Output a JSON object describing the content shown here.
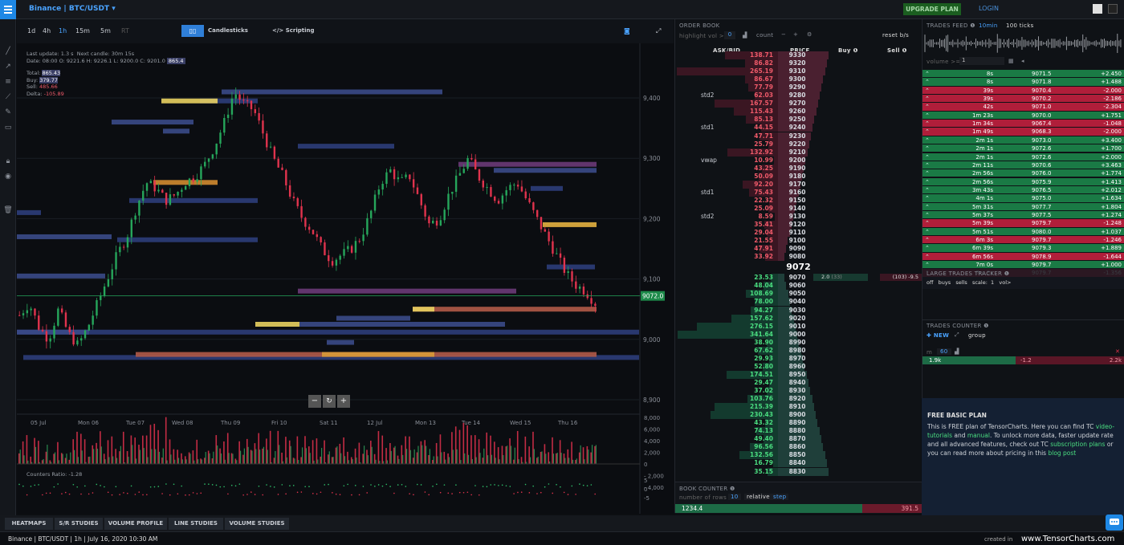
{
  "app": {
    "pair": "Binance | BTC/USDT",
    "upgrade": "UPGRADE PLAN",
    "login": "LOGIN"
  },
  "chart": {
    "timeframes": [
      "1d",
      "4h",
      "1h",
      "15m",
      "5m",
      "RT"
    ],
    "active_tf": "1h",
    "type_label": "Candlesticks",
    "scripting": "</> Scripting",
    "info": {
      "last_update": "Last update: 1.3 s",
      "next_candle": "Next candle: 30m 15s",
      "ohlc": "Date: 08:00 O: 9221.6 H: 9226.1 L: 9200.0 C: 9201.0",
      "vol": "865.4",
      "total_label": "Total:",
      "total": "865.43",
      "buy_label": "Buy:",
      "buy": "379.77",
      "sell_label": "Sell:",
      "sell": "485.66",
      "delta_label": "Delta:",
      "delta": "-105.89"
    },
    "price_ticks": [
      "9,400",
      "9,300",
      "9,200",
      "9,100",
      "9,000",
      "8,900"
    ],
    "current_price": "9072.0",
    "dates": [
      "05 Jul",
      "Mon 06",
      "Tue 07",
      "Wed 08",
      "Thu 09",
      "Fri 10",
      "Sat 11",
      "12 Jul",
      "Mon 13",
      "Tue 14",
      "Wed 15",
      "Thu 16"
    ],
    "vol_ticks": [
      "8,000",
      "6,000",
      "4,000",
      "2,000",
      "0",
      "2,000",
      "4,000"
    ],
    "ratio_label": "Counters Ratio:",
    "ratio": "-1.28",
    "ratio_ticks": [
      "5",
      "0",
      "-5"
    ]
  },
  "orderbook": {
    "title": "ORDER BOOK",
    "highlight": "highlight vol >",
    "hl_val": "0",
    "count": "count",
    "reset": "reset b/s",
    "cols": [
      "ASK/BID",
      "PRICE",
      "Buy ❶",
      "Sell ❶"
    ],
    "asks": [
      [
        "138.71",
        "9330"
      ],
      [
        "86.82",
        "9320"
      ],
      [
        "265.19",
        "9310"
      ],
      [
        "86.67",
        "9300"
      ],
      [
        "77.79",
        "9290"
      ],
      [
        "62.03",
        "9280"
      ],
      [
        "167.57",
        "9270"
      ],
      [
        "115.43",
        "9260"
      ],
      [
        "85.13",
        "9250"
      ],
      [
        "44.15",
        "9240"
      ],
      [
        "47.71",
        "9230"
      ],
      [
        "25.79",
        "9220"
      ],
      [
        "132.92",
        "9210"
      ],
      [
        "10.99",
        "9200"
      ],
      [
        "43.25",
        "9190"
      ],
      [
        "50.09",
        "9180"
      ],
      [
        "92.20",
        "9170"
      ],
      [
        "75.43",
        "9160"
      ],
      [
        "22.32",
        "9150"
      ],
      [
        "25.09",
        "9140"
      ],
      [
        "8.59",
        "9130"
      ],
      [
        "35.41",
        "9120"
      ],
      [
        "29.04",
        "9110"
      ],
      [
        "21.55",
        "9100"
      ],
      [
        "47.91",
        "9090"
      ],
      [
        "33.92",
        "9080"
      ]
    ],
    "labels": [
      {
        "row": 5,
        "t": "std2"
      },
      {
        "row": 9,
        "t": "std1"
      },
      {
        "row": 13,
        "t": "vwap"
      },
      {
        "row": 17,
        "t": "std1"
      },
      {
        "row": 20,
        "t": "std2"
      }
    ],
    "mid": "9072",
    "bids": [
      [
        "23.53",
        "9070"
      ],
      [
        "48.04",
        "9060"
      ],
      [
        "108.69",
        "9050"
      ],
      [
        "78.00",
        "9040"
      ],
      [
        "94.27",
        "9030"
      ],
      [
        "157.62",
        "9020"
      ],
      [
        "276.15",
        "9010"
      ],
      [
        "341.64",
        "9000"
      ],
      [
        "38.90",
        "8990"
      ],
      [
        "67.62",
        "8980"
      ],
      [
        "29.93",
        "8970"
      ],
      [
        "52.80",
        "8960"
      ],
      [
        "174.51",
        "8950"
      ],
      [
        "29.47",
        "8940"
      ],
      [
        "37.02",
        "8930"
      ],
      [
        "103.76",
        "8920"
      ],
      [
        "215.39",
        "8910"
      ],
      [
        "230.43",
        "8900"
      ],
      [
        "43.32",
        "8890"
      ],
      [
        "74.13",
        "8880"
      ],
      [
        "49.40",
        "8870"
      ],
      [
        "96.56",
        "8860"
      ],
      [
        "132.56",
        "8850"
      ],
      [
        "16.79",
        "8840"
      ],
      [
        "35.15",
        "8830"
      ]
    ],
    "buy_val": "2.0",
    "buy_sub": "(33)",
    "sell_val": "(103) -9.5",
    "counter": {
      "title": "BOOK COUNTER ❶",
      "rows": "number of rows",
      "rows_val": "10",
      "relative": "relative",
      "step": "step",
      "bid": "1234.4",
      "ask": "391.5"
    }
  },
  "trades": {
    "title": "TRADES FEED ❶",
    "tf": "10min",
    "ticks": "100 ticks",
    "volume": "volume >=",
    "vol_val": "1",
    "rows": [
      [
        "8s",
        "9071.5",
        "+2.450",
        "b"
      ],
      [
        "8s",
        "9071.8",
        "+1.488",
        "b"
      ],
      [
        "39s",
        "9070.4",
        "-2.000",
        "s"
      ],
      [
        "39s",
        "9070.2",
        "-2.186",
        "s"
      ],
      [
        "42s",
        "9071.0",
        "-2.304",
        "s"
      ],
      [
        "1m 23s",
        "9070.0",
        "+1.751",
        "b"
      ],
      [
        "1m 34s",
        "9067.4",
        "-1.048",
        "s"
      ],
      [
        "1m 49s",
        "9068.3",
        "-2.000",
        "s"
      ],
      [
        "2m 1s",
        "9073.0",
        "+3.400",
        "b"
      ],
      [
        "2m 1s",
        "9072.6",
        "+1.700",
        "b"
      ],
      [
        "2m 1s",
        "9072.6",
        "+2.000",
        "b"
      ],
      [
        "2m 11s",
        "9070.6",
        "+3.463",
        "b"
      ],
      [
        "2m 56s",
        "9076.0",
        "+1.774",
        "b"
      ],
      [
        "2m 56s",
        "9075.9",
        "+1.413",
        "b"
      ],
      [
        "3m 43s",
        "9076.5",
        "+2.012",
        "b"
      ],
      [
        "4m 1s",
        "9075.0",
        "+1.634",
        "b"
      ],
      [
        "5m 31s",
        "9077.7",
        "+1.804",
        "b"
      ],
      [
        "5m 37s",
        "9077.5",
        "+1.274",
        "b"
      ],
      [
        "5m 39s",
        "9079.7",
        "-1.248",
        "s"
      ],
      [
        "5m 51s",
        "9080.0",
        "+1.037",
        "b"
      ],
      [
        "6m 3s",
        "9079.7",
        "-1.246",
        "s"
      ],
      [
        "6m 39s",
        "9079.3",
        "+1.889",
        "b"
      ],
      [
        "6m 56s",
        "9078.9",
        "-1.644",
        "s"
      ],
      [
        "7m 0s",
        "9079.7",
        "+1.000",
        "b"
      ],
      [
        "7m 3s",
        "9079.7",
        "-1.356",
        "s"
      ]
    ],
    "large": "LARGE TRADES TRACKER ❶",
    "large_opts": [
      "off",
      "buys",
      "sells",
      "scale:",
      "1",
      "vol>"
    ],
    "counter": "TRADES COUNTER ❶",
    "new": "✚ NEW",
    "group": "group",
    "m": "m",
    "m_val": "60",
    "buy_cnt": "1.9k",
    "delta": "-1.2",
    "sell_cnt": "2.2k",
    "plan": {
      "title": "FREE BASIC PLAN",
      "p1": "This is FREE plan of TensorCharts. Here you can find TC ",
      "l1": "video-tutorials",
      "p2": " and ",
      "l2": "manual",
      "p3": ". To unlock more data, faster update rate and all advanced features, check out TC ",
      "l3": "subscription plans",
      "p4": " or you can read more about pricing in this ",
      "l4": "blog post"
    }
  },
  "tabs": [
    "HEATMAPS",
    "S/R STUDIES",
    "VOLUME PROFILE",
    "LINE STUDIES",
    "VOLUME STUDIES"
  ],
  "status": {
    "left": "Binance | BTC/USDT | 1h | July 16, 2020 10:30 AM",
    "created": "created in",
    "brand": "www.TensorCharts.com"
  },
  "colors": {
    "up": "#26a65b",
    "down": "#e0334d",
    "accent": "#1e88e5"
  }
}
